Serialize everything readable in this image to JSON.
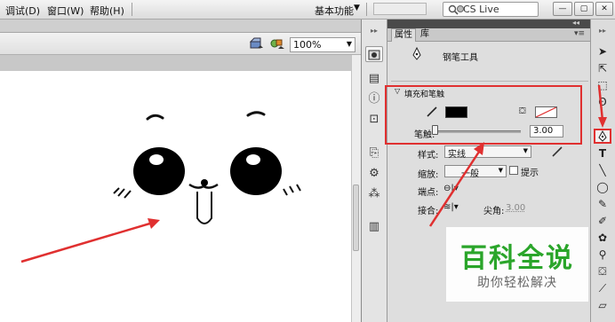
{
  "menu": {
    "items": [
      "调试(D)",
      "窗口(W)",
      "帮助(H)"
    ],
    "workspace_label": "基本功能",
    "search_label": "CS Live",
    "window_buttons": [
      "—",
      "▢",
      "✕"
    ]
  },
  "document": {
    "zoom": "100%"
  },
  "panel": {
    "tabs": [
      "属性",
      "库"
    ],
    "tool_name": "钢笔工具",
    "section_title": "填充和笔触",
    "stroke_label": "笔触:",
    "stroke_value": "3.00",
    "style_label": "样式:",
    "style_value": "实线",
    "scale_label": "缩放:",
    "scale_value": "一般",
    "hint_label": "提示",
    "cap_label": "端点:",
    "join_label": "接合:",
    "miter_label": "尖角:",
    "miter_value": "3.00"
  },
  "watermark": {
    "title": "百科全说",
    "subtitle": "助你轻松解决"
  },
  "colors": {
    "annotation_red": "#e03030",
    "stroke_color": "#000000",
    "watermark_green": "#2aa52a"
  },
  "icons": {
    "tools": [
      "selection-tool-icon",
      "subselection-tool-icon",
      "free-transform-tool-icon",
      "lasso-tool-icon",
      "pen-tool-icon",
      "text-tool-icon",
      "line-tool-icon",
      "rectangle-tool-icon",
      "pencil-tool-icon",
      "brush-tool-icon",
      "deco-tool-icon",
      "bone-tool-icon",
      "paint-bucket-tool-icon",
      "eyedropper-tool-icon",
      "eraser-tool-icon"
    ]
  }
}
